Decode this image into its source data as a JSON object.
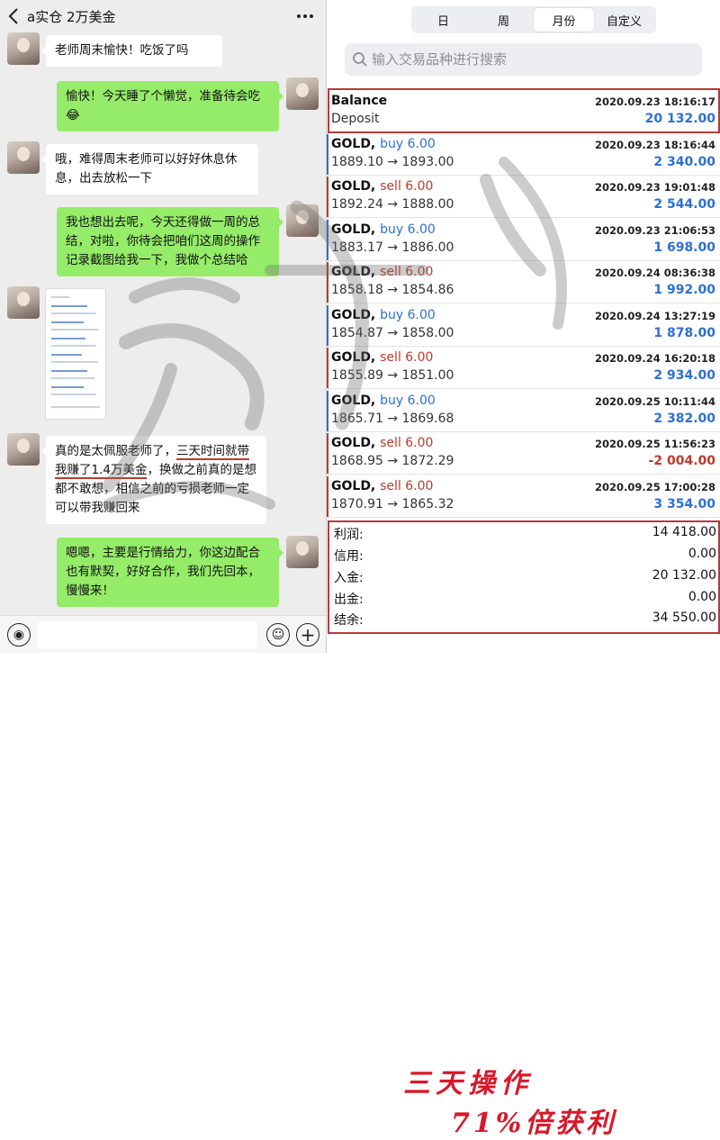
{
  "chat": {
    "title": "a实仓 2万美金",
    "messages": [
      {
        "side": "in",
        "text": "老师周末愉快！吃饭了吗"
      },
      {
        "side": "out",
        "lines": [
          "愉快！今天睡了个懒觉，准备待会吃",
          "😂"
        ]
      },
      {
        "side": "in",
        "lines": [
          "哦，难得周末老师可以好好休息休",
          "息，出去放松一下"
        ]
      },
      {
        "side": "out",
        "lines": [
          "我也想出去呢，今天还得做一周的总",
          "结，对啦，你待会把咱们这周的操作",
          "记录截图给我一下，我做个总结哈"
        ]
      },
      {
        "side": "in",
        "lines": [
          "真的是太佩服老师了，",
          "三天时间就带",
          "我赚了1.4万美金",
          "，换做之前真的是想",
          "都不敢想，相信之前的亏损老师一定",
          "可以带我赚回来"
        ]
      },
      {
        "side": "out",
        "lines": [
          "嗯嗯，主要是行情给力，你这边配合",
          "也有默契，好好合作，我们先回本，",
          "慢慢来！"
        ]
      }
    ]
  },
  "history": {
    "tabs": [
      "日",
      "周",
      "月份",
      "自定义"
    ],
    "active_tab": "月份",
    "search_placeholder": "输入交易品种进行搜索",
    "balance": {
      "title": "Balance",
      "date": "2020.09.23 18:16:17",
      "label": "Deposit",
      "amount": "20 132.00"
    },
    "trades": [
      {
        "symbol": "GOLD,",
        "side": "buy",
        "lots": "buy 6.00",
        "date": "2020.09.23 18:16:44",
        "prices": "1889.10 → 1893.00",
        "profit": "2 340.00"
      },
      {
        "symbol": "GOLD,",
        "side": "sell",
        "lots": "sell 6.00",
        "date": "2020.09.23 19:01:48",
        "prices": "1892.24 → 1888.00",
        "profit": "2 544.00"
      },
      {
        "symbol": "GOLD,",
        "side": "buy",
        "lots": "buy 6.00",
        "date": "2020.09.23 21:06:53",
        "prices": "1883.17 → 1886.00",
        "profit": "1 698.00"
      },
      {
        "symbol": "GOLD,",
        "side": "sell",
        "lots": "sell 6.00",
        "date": "2020.09.24 08:36:38",
        "prices": "1858.18 → 1854.86",
        "profit": "1 992.00"
      },
      {
        "symbol": "GOLD,",
        "side": "buy",
        "lots": "buy 6.00",
        "date": "2020.09.24 13:27:19",
        "prices": "1854.87 → 1858.00",
        "profit": "1 878.00"
      },
      {
        "symbol": "GOLD,",
        "side": "sell",
        "lots": "sell 6.00",
        "date": "2020.09.24 16:20:18",
        "prices": "1855.89 → 1851.00",
        "profit": "2 934.00"
      },
      {
        "symbol": "GOLD,",
        "side": "buy",
        "lots": "buy 6.00",
        "date": "2020.09.25 10:11:44",
        "prices": "1865.71 → 1869.68",
        "profit": "2 382.00"
      },
      {
        "symbol": "GOLD,",
        "side": "sell",
        "lots": "sell 6.00",
        "date": "2020.09.25 11:56:23",
        "prices": "1868.95 → 1872.29",
        "profit": "-2 004.00"
      },
      {
        "symbol": "GOLD,",
        "side": "sell",
        "lots": "sell 6.00",
        "date": "2020.09.25 17:00:28",
        "prices": "1870.91 → 1865.32",
        "profit": "3 354.00"
      }
    ],
    "summary": [
      {
        "label": "利润:",
        "value": "14 418.00"
      },
      {
        "label": "信用:",
        "value": "0.00"
      },
      {
        "label": "入金:",
        "value": "20 132.00"
      },
      {
        "label": "出金:",
        "value": "0.00"
      },
      {
        "label": "结余:",
        "value": "34 550.00"
      }
    ],
    "overlay_line1": "三天操作",
    "overlay_line2": "71%倍获利"
  },
  "colors": {
    "buy": "#2d6fd6",
    "sell": "#c0392b",
    "bubble_out": "#95ec69",
    "highlight_box": "#b53a3a"
  }
}
